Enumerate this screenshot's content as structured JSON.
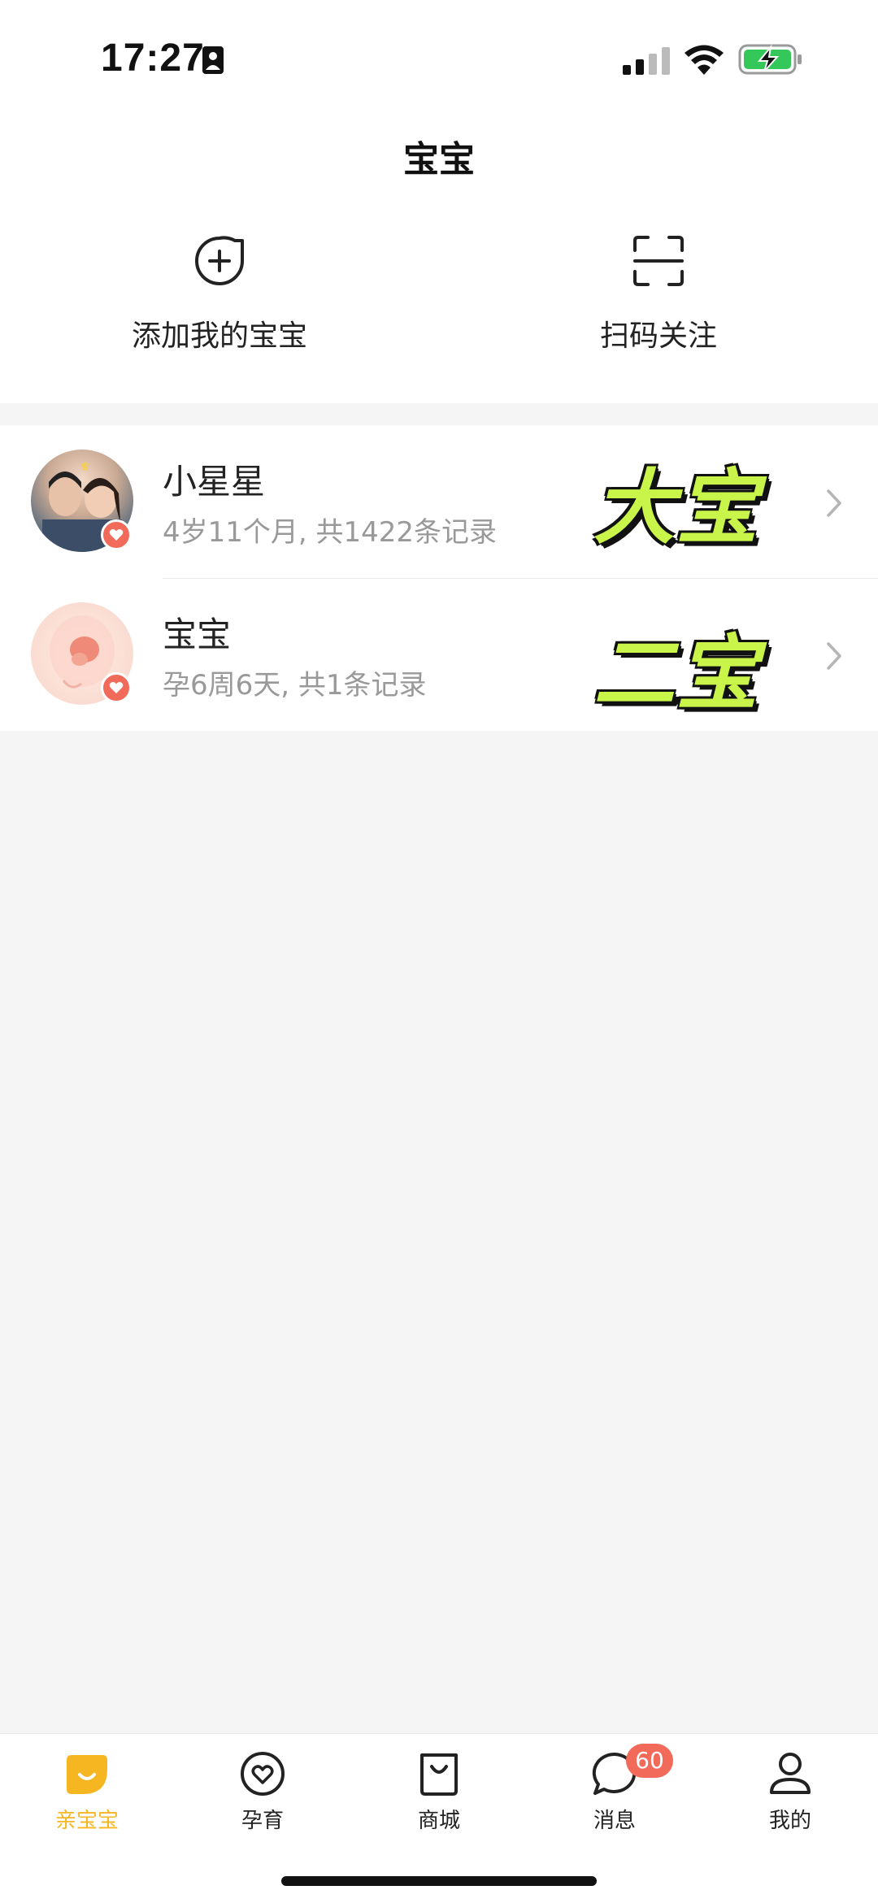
{
  "status_bar": {
    "time": "17:27",
    "icons": [
      "id-card-icon",
      "signal-icon",
      "wifi-icon",
      "battery-charging-icon"
    ]
  },
  "header": {
    "title": "宝宝",
    "actions": [
      {
        "label": "添加我的宝宝",
        "icon": "add-bubble-icon"
      },
      {
        "label": "扫码关注",
        "icon": "scan-icon"
      }
    ]
  },
  "babies": [
    {
      "name": "小星星",
      "meta": "4岁11个月, 共1422条记录",
      "sticker": "大宝",
      "avatar": "family-photo"
    },
    {
      "name": "宝宝",
      "meta": "孕6周6天, 共1条记录",
      "sticker": "二宝",
      "avatar": "fetus-illustration"
    }
  ],
  "tab_bar": {
    "tabs": [
      {
        "label": "亲宝宝",
        "icon": "home-leaf-icon",
        "active": true
      },
      {
        "label": "孕育",
        "icon": "heart-circle-icon",
        "active": false
      },
      {
        "label": "商城",
        "icon": "shopping-bag-icon",
        "active": false
      },
      {
        "label": "消息",
        "icon": "chat-bubble-icon",
        "active": false,
        "badge": "60"
      },
      {
        "label": "我的",
        "icon": "user-icon",
        "active": false
      }
    ]
  },
  "colors": {
    "accent": "#f5b622",
    "badge": "#f26a5a",
    "sticker": "#c9f54a",
    "background": "#f5f5f5"
  }
}
